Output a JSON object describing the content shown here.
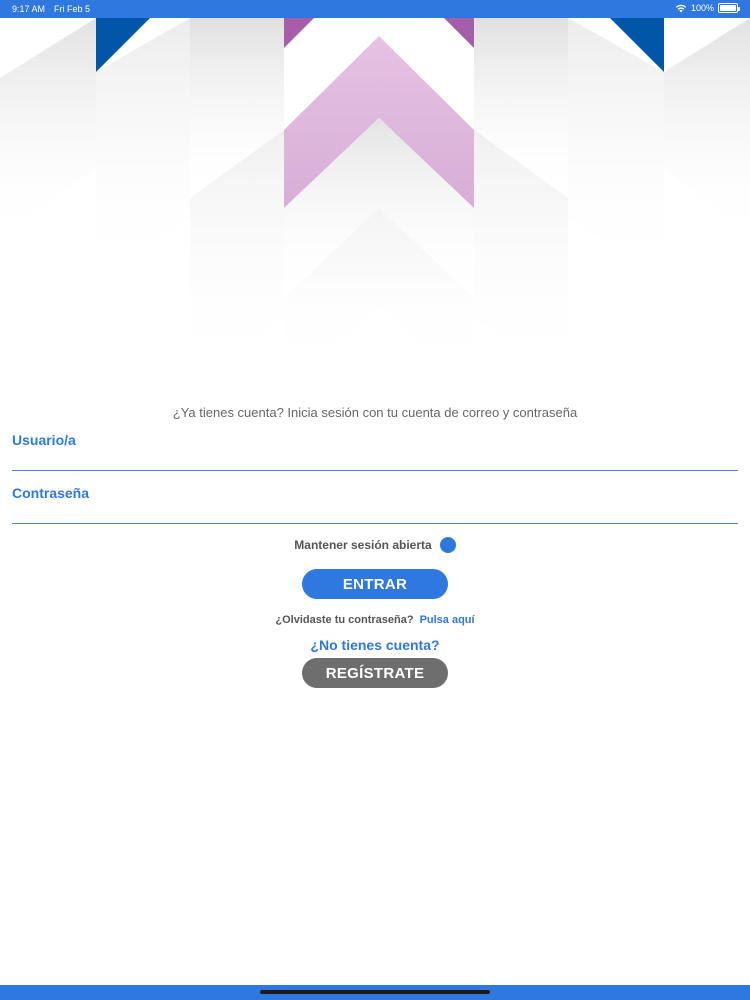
{
  "status_bar": {
    "time": "9:17 AM",
    "date": "Fri Feb 5",
    "battery": "100%"
  },
  "hero": {
    "colors": {
      "blue": "#0057a8",
      "purple": "#a45fa8",
      "pink": "#ddb6dc",
      "grey": "#dcdcdc"
    }
  },
  "login": {
    "intro": "¿Ya tienes cuenta? Inicia sesión con tu cuenta de correo y contraseña",
    "username_label": "Usuario/a",
    "username_value": "",
    "password_label": "Contraseña",
    "password_value": "",
    "keep_session_label": "Mantener sesión abierta",
    "keep_session_on": true,
    "enter_button": "ENTRAR",
    "forgot_text": "¿Olvidaste tu contraseña?",
    "forgot_link": "Pulsa aquí",
    "no_account": "¿No tienes cuenta?",
    "register_button": "REGÍSTRATE"
  },
  "colors": {
    "accent": "#2f78e0",
    "secondary_button": "#6e6e6e"
  }
}
